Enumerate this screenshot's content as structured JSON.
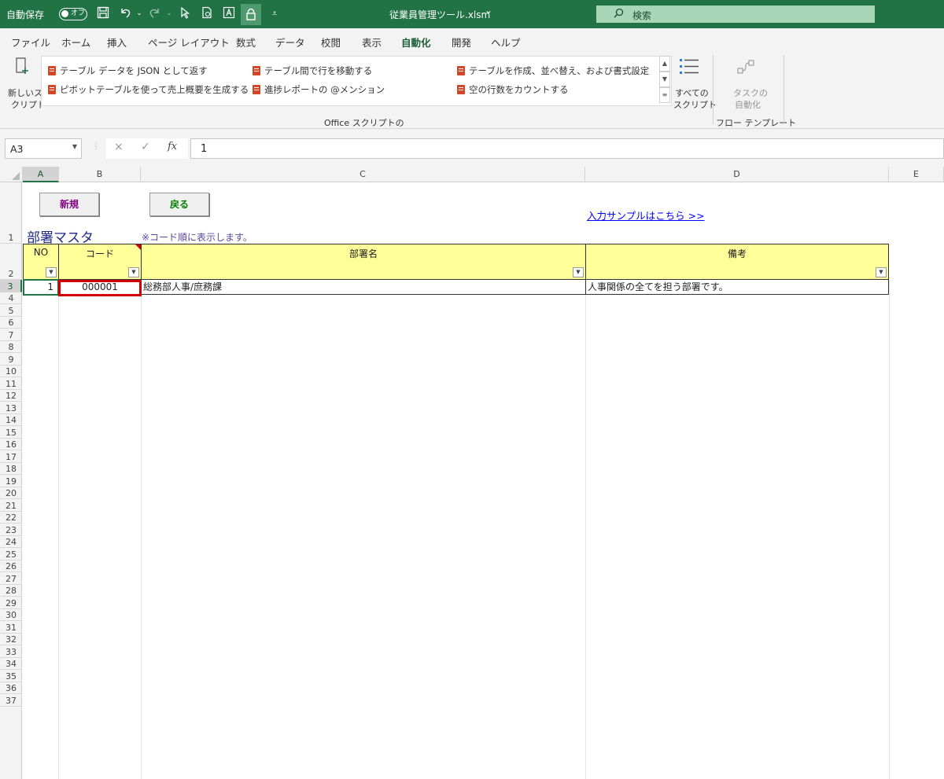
{
  "titlebar": {
    "autosave_label": "自動保存",
    "autosave_state": "オフ",
    "filename": "従業員管理ツール.xlsm",
    "filename_chevron": "⌄",
    "search_placeholder": "検索"
  },
  "menu": {
    "tabs": [
      "ファイル",
      "ホーム",
      "挿入",
      "ページ レイアウト",
      "数式",
      "データ",
      "校閲",
      "表示",
      "自動化",
      "開発",
      "ヘルプ"
    ],
    "active_tab": "自動化"
  },
  "ribbon": {
    "new_script_line1": "新しいス",
    "new_script_line2": "クリプト",
    "scripts": [
      "テーブル データを JSON として返す",
      "ピボットテーブルを使って売上概要を生成する",
      "テーブル間で行を移動する",
      "進捗レポートの @メンション",
      "テーブルを作成、並べ替え、および書式設定",
      "空の行数をカウントする"
    ],
    "all_scripts_line1": "すべての",
    "all_scripts_line2": "スクリプト",
    "group1_label": "Office スクリプトの",
    "task_automation_line1": "タスクの",
    "task_automation_line2": "自動化",
    "group2_label": "フロー テンプレート"
  },
  "formula": {
    "namebox": "A3",
    "cancel": "×",
    "enter": "✓",
    "fx": "fx",
    "value": "1"
  },
  "grid": {
    "columns": [
      "A",
      "B",
      "C",
      "D",
      "E"
    ],
    "selected_column": "A",
    "selected_row": "3",
    "rows": [
      "1",
      "2",
      "3",
      "4",
      "5",
      "6",
      "7",
      "8",
      "9",
      "10",
      "11",
      "12",
      "13",
      "14",
      "15",
      "16",
      "17",
      "18",
      "19",
      "20",
      "21",
      "22",
      "23",
      "24",
      "25",
      "26",
      "27",
      "28",
      "29",
      "30",
      "31",
      "32",
      "33",
      "34",
      "35",
      "36",
      "37"
    ]
  },
  "sheet": {
    "button_new": "新規",
    "button_back": "戻る",
    "link_sample": "入力サンプルはこちら >>",
    "title": "部署マスタ",
    "note": "※コード順に表示します。",
    "headers": [
      "NO",
      "コード",
      "部署名",
      "備考"
    ],
    "row": {
      "no": "1",
      "code": "000001",
      "name": "総務部人事/庶務課",
      "remarks": "人事関係の全てを担う部署です。"
    },
    "colors": {
      "header_fill": "#ffff99",
      "title": "#1f2a80",
      "button_new_text": "#800080",
      "button_back_text": "#008000",
      "selection_red": "#d40000",
      "excel_green": "#217346"
    }
  }
}
